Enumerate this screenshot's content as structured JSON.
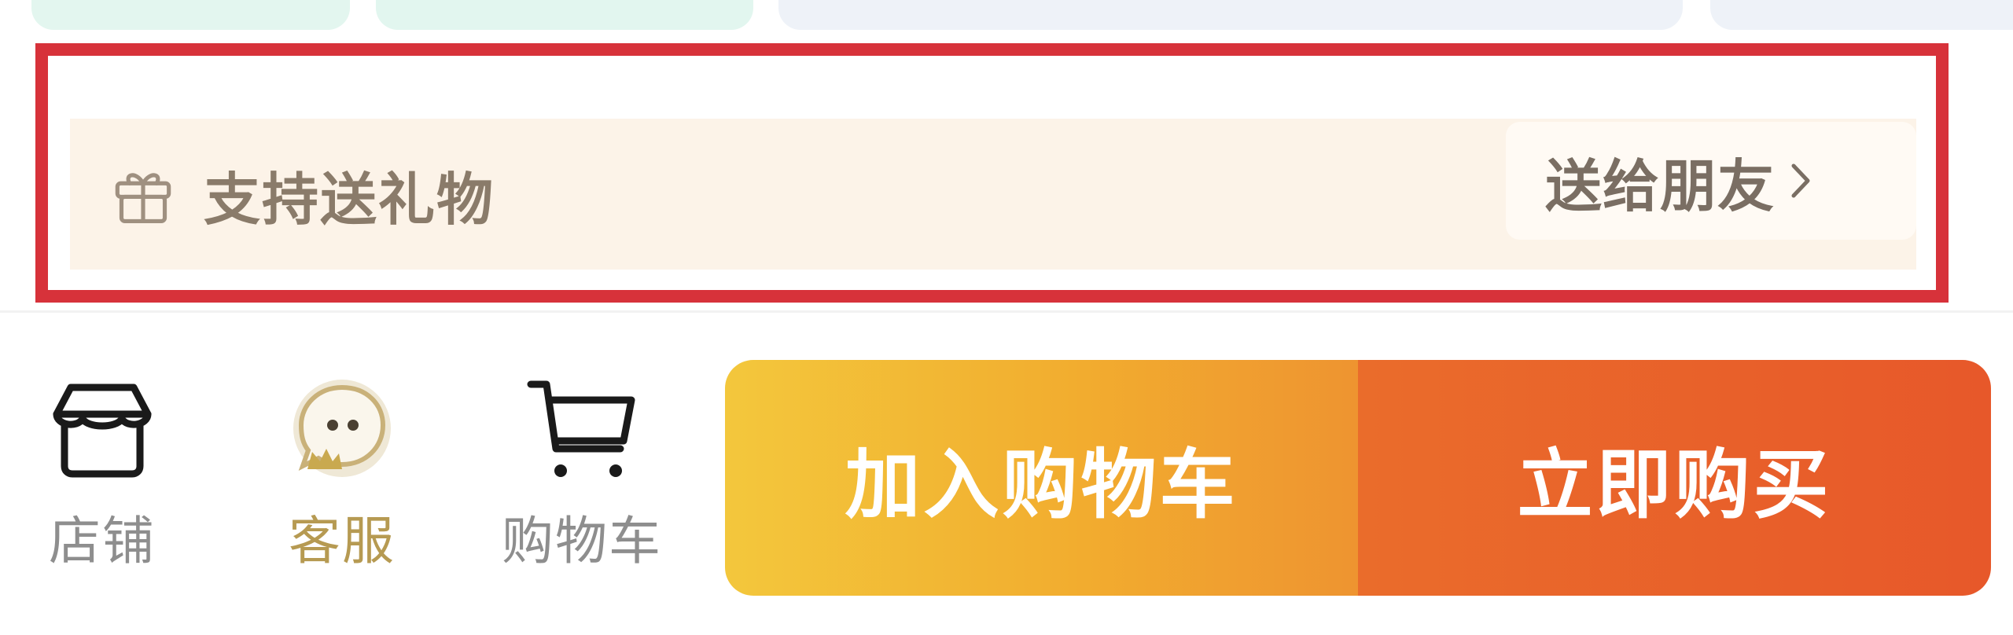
{
  "gift": {
    "text": "支持送礼物",
    "send_label": "送给朋友",
    "highlight_color": "#d7323a"
  },
  "bottom_bar": {
    "shop_label": "店铺",
    "service_label": "客服",
    "cart_label": "购物车",
    "add_to_cart_label": "加入购物车",
    "buy_now_label": "立即购买"
  },
  "colors": {
    "gift_banner_bg": "#fcf3e8",
    "service_gold": "#b69a52",
    "add_to_cart_gradient": [
      "#f3c73c",
      "#ee9430"
    ],
    "buy_now_color": "#e7582a"
  },
  "icons": {
    "gift": "gift-icon",
    "chevron": "chevron-right-icon",
    "shop": "store-icon",
    "service": "chat-bubble-icon",
    "cart": "shopping-cart-icon"
  }
}
